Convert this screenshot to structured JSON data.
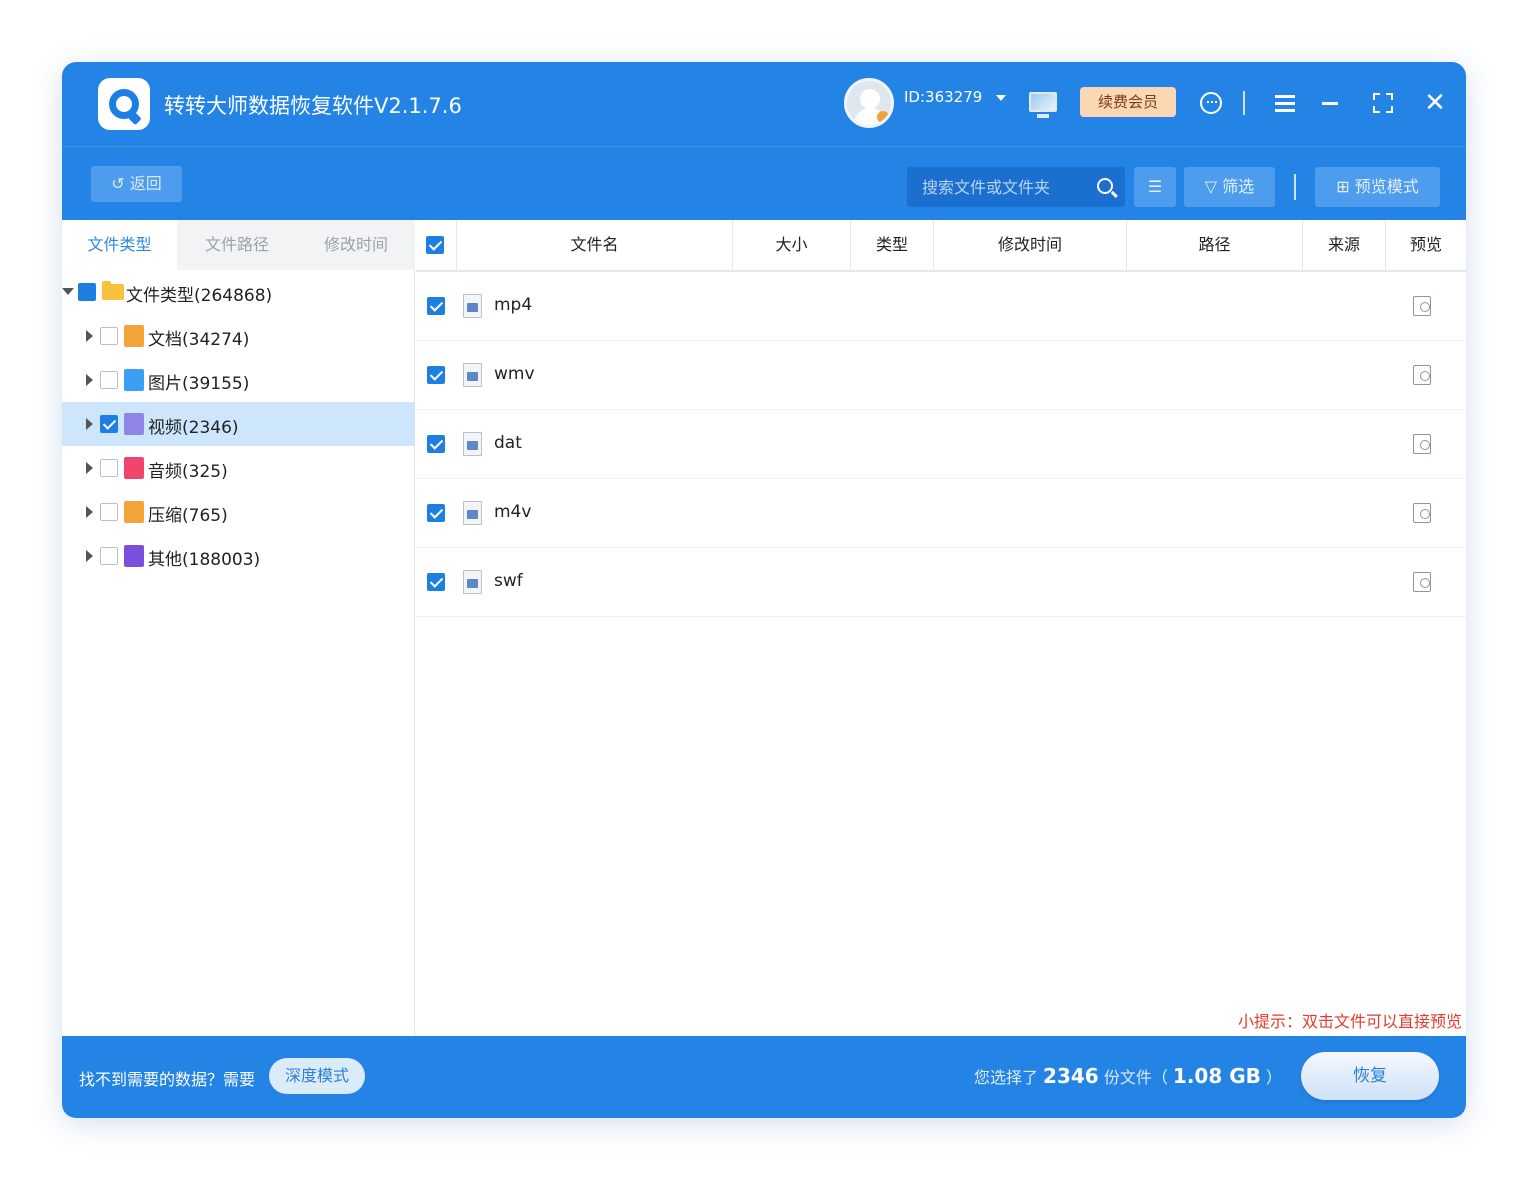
{
  "app": {
    "title": "转转大师数据恢复软件V2.1.7.6",
    "user_id": "ID:363279",
    "vip_label": "续费会员"
  },
  "icons": {
    "logo": "app-logo-icon",
    "avatar": "user-avatar-icon",
    "monitor": "monitor-icon",
    "support": "customer-service-icon",
    "menu": "menu-icon",
    "minimize": "minimize-icon",
    "maximize": "maximize-icon",
    "close": "close-icon"
  },
  "toolbar": {
    "back_label": "↺ 返回",
    "search_placeholder": "搜索文件或文件夹",
    "filter_label": "筛选",
    "preview_mode_label": "预览模式"
  },
  "left_panel": {
    "tabs": [
      "文件类型",
      "文件路径",
      "修改时间"
    ],
    "active_tab": 0,
    "root": {
      "label": "文件类型(264868)"
    },
    "items": [
      {
        "label": "文档(34274)",
        "checked": false,
        "icon_color": "#f5a43a"
      },
      {
        "label": "图片(39155)",
        "checked": false,
        "icon_color": "#3a9ef5"
      },
      {
        "label": "视频(2346)",
        "checked": true,
        "icon_color": "#8f85e8",
        "selected": true
      },
      {
        "label": "音频(325)",
        "checked": false,
        "icon_color": "#f0466e"
      },
      {
        "label": "压缩(765)",
        "checked": false,
        "icon_color": "#f5a43a"
      },
      {
        "label": "其他(188003)",
        "checked": false,
        "icon_color": "#7a4fe0"
      }
    ]
  },
  "table": {
    "columns": [
      "文件名",
      "大小",
      "类型",
      "修改时间",
      "路径",
      "来源",
      "预览"
    ],
    "rows": [
      {
        "name": "mp4",
        "checked": true
      },
      {
        "name": "wmv",
        "checked": true
      },
      {
        "name": "dat",
        "checked": true
      },
      {
        "name": "m4v",
        "checked": true
      },
      {
        "name": "swf",
        "checked": true
      }
    ],
    "tip": "小提示：双击文件可以直接预览"
  },
  "footer": {
    "prompt": "找不到需要的数据？需要",
    "deep_mode_label": "深度模式",
    "summary_prefix": "您选择了",
    "selected_count": "2346",
    "summary_mid": "份文件（",
    "selected_size": "1.08 GB",
    "summary_suffix": "）",
    "recover_label": "恢复"
  },
  "colors": {
    "primary": "#2484e6",
    "selected_row": "#cde6fb",
    "tip": "#e33b2e",
    "vip": "#fcd7b3"
  }
}
